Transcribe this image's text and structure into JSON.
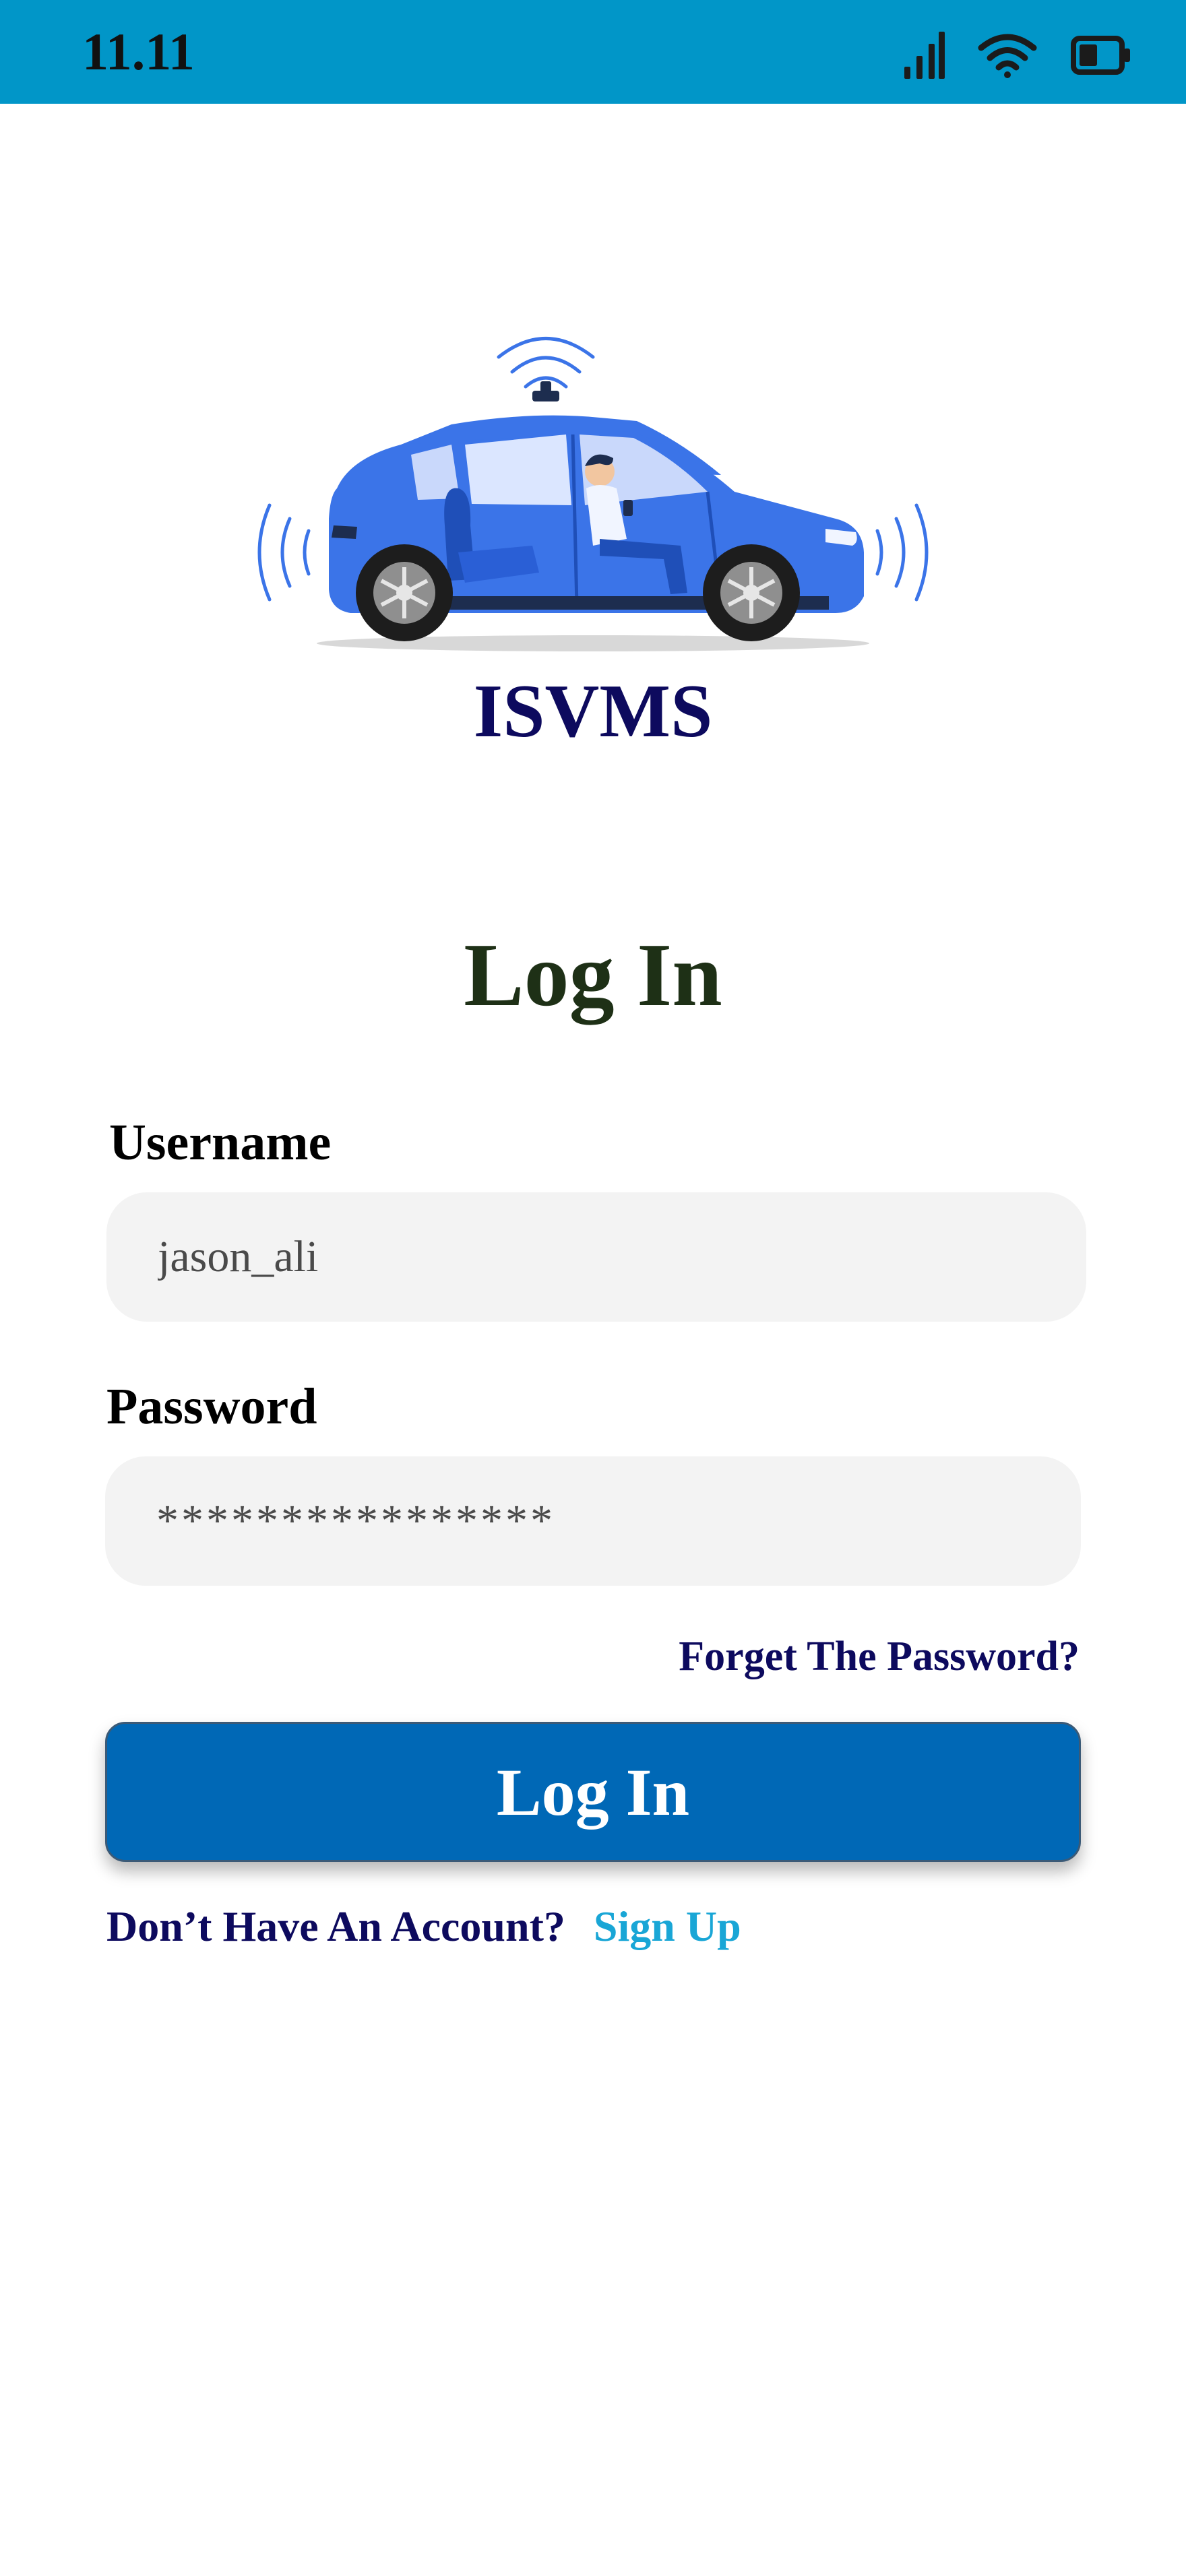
{
  "status_bar": {
    "time": "11.11",
    "icons": [
      "signal-icon",
      "wifi-icon",
      "battery-icon"
    ]
  },
  "logo": {
    "illustration": "self-driving-car-illustration",
    "app_name": "ISVMS"
  },
  "page": {
    "title": "Log In"
  },
  "form": {
    "username_label": "Username",
    "username_value": "jason_ali",
    "password_label": "Password",
    "password_value": "****************",
    "forgot_password": "Forget The Password?",
    "submit_label": "Log In"
  },
  "signup": {
    "prompt": "Don’t Have An Account?",
    "link": "Sign Up"
  },
  "colors": {
    "status_bar": "#0196c8",
    "primary_button": "#0068b6",
    "brand_text": "#0d0a5e",
    "title_text": "#1e3016",
    "link_accent": "#19a6d6",
    "input_background": "#f3f3f3",
    "car_body": "#3b74e8"
  }
}
